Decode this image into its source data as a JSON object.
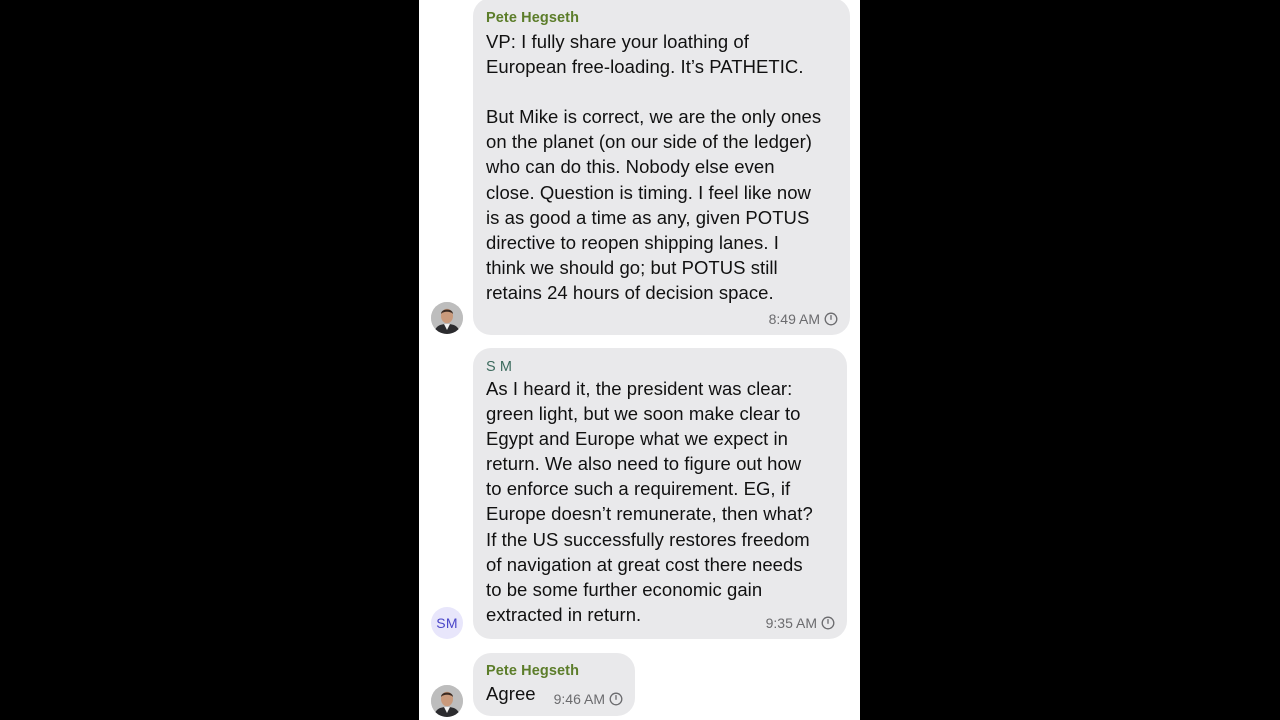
{
  "messages": [
    {
      "sender": "Pete Hegseth",
      "text": "VP: I fully share your loathing of\nEuropean free-loading. It’s PATHETIC.\n\nBut Mike is correct, we are the only ones\non the planet (on our side of the ledger)\nwho can do this. Nobody else even\nclose. Question is timing. I feel like now\nis as good a time as any, given POTUS\ndirective to reopen shipping lanes. I\nthink we should go; but POTUS still\nretains 24 hours of decision space.",
      "time": "8:49 AM",
      "avatar": "profile-photo"
    },
    {
      "sender": "S M",
      "text": "As I heard it, the president was clear:\ngreen light, but we soon make clear to\nEgypt and Europe what we expect in\nreturn. We also need to figure out how\nto enforce such a requirement. EG, if\nEurope doesn’t remunerate, then what?\nIf the US successfully restores freedom\nof navigation at great cost there needs\nto be some further economic gain\nextracted in return.",
      "time": "9:35 AM",
      "avatar_initials": "SM"
    },
    {
      "sender": "Pete Hegseth",
      "text": "Agree",
      "time": "9:46 AM",
      "avatar": "profile-photo"
    }
  ],
  "icons": {
    "status": "clock-icon"
  },
  "colors": {
    "bubble": "#e9e9eb",
    "sender_green": "#5c7d2a",
    "sender_teal": "#3d6b5e",
    "initials_bg": "#e8e6fb",
    "initials_fg": "#4a46c8"
  }
}
